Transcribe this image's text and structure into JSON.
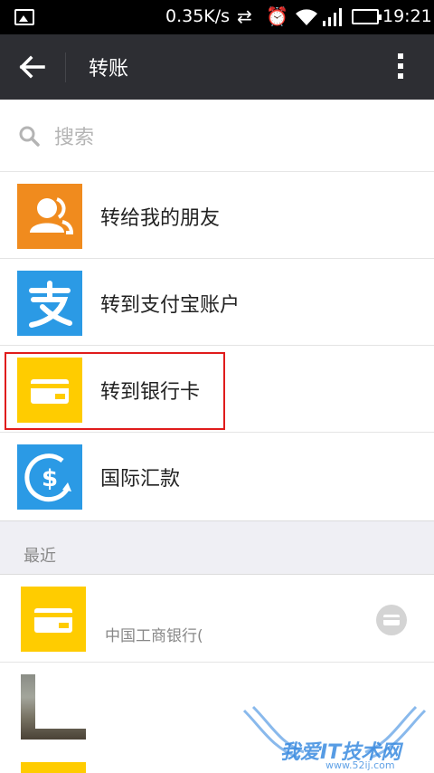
{
  "status_bar": {
    "speed": "0.35K/s",
    "time": "19:21",
    "icons": [
      "image-icon",
      "sync-icon",
      "alarm-icon",
      "wifi-icon",
      "signal-icon",
      "battery-icon"
    ]
  },
  "header": {
    "title": "转账"
  },
  "search": {
    "placeholder": "搜索"
  },
  "options": [
    {
      "label": "转给我的朋友",
      "icon": "friends-icon",
      "color": "#f08b1e"
    },
    {
      "label": "转到支付宝账户",
      "icon": "alipay-icon",
      "color": "#2b9ae5"
    },
    {
      "label": "转到银行卡",
      "icon": "bank-card-icon",
      "color": "#ffcc00"
    },
    {
      "label": "国际汇款",
      "icon": "international-remit-icon",
      "color": "#2b9ae5"
    }
  ],
  "recent": {
    "heading": "最近",
    "items": [
      {
        "name": "",
        "sub": "中国工商银行(",
        "icon": "bank-card-icon"
      }
    ]
  },
  "watermark": {
    "text": "我爱IT技术网",
    "url": "www.52ij.com"
  },
  "colors": {
    "header_bg": "#2d2e33",
    "highlight": "#e01c1c",
    "section_bg": "#efeff4"
  }
}
